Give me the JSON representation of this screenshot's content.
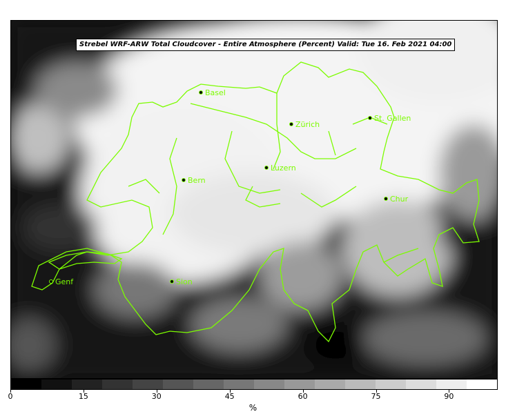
{
  "title": "Strebel WRF-ARW Total Cloudcover - Entire Atmosphere (Percent)   Valid: Tue 16. Feb 2021 04:00",
  "colorbar": {
    "unit": "%",
    "ticks": [
      "0",
      "15",
      "30",
      "45",
      "60",
      "75",
      "90"
    ],
    "colors": [
      "#000000",
      "#111111",
      "#222222",
      "#333333",
      "#444444",
      "#555555",
      "#666666",
      "#777777",
      "#888888",
      "#999999",
      "#aaaaaa",
      "#bbbbbb",
      "#cccccc",
      "#dddddd",
      "#eeeeee",
      "#ffffff"
    ]
  },
  "cities": [
    {
      "name": "Basel"
    },
    {
      "name": "Zürich"
    },
    {
      "name": "St. Gallen"
    },
    {
      "name": "Bern"
    },
    {
      "name": "Luzern"
    },
    {
      "name": "Chur"
    },
    {
      "name": "Genf"
    },
    {
      "name": "Sion"
    }
  ],
  "colors": {
    "border": "#7CFC00",
    "marker": "#000000"
  }
}
